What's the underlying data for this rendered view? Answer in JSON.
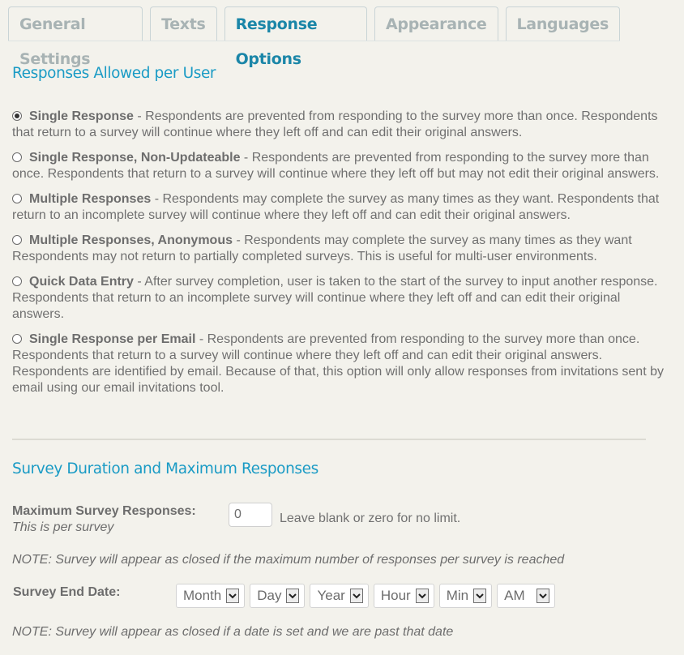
{
  "tabs": [
    {
      "label": "General Settings",
      "active": false
    },
    {
      "label": "Texts",
      "active": false
    },
    {
      "label": "Response Options",
      "active": true
    },
    {
      "label": "Appearance",
      "active": false
    },
    {
      "label": "Languages",
      "active": false
    }
  ],
  "responses_section": {
    "title": "Responses Allowed per User",
    "options": [
      {
        "title": "Single Response",
        "description": " - Respondents are prevented from responding to the survey more than once. Respondents that return to a survey will continue where they left off and can edit their original answers.",
        "checked": true
      },
      {
        "title": "Single Response, Non-Updateable",
        "description": " - Respondents are prevented from responding to the survey more than once. Respondents that return to a survey will continue where they left off but may not edit their original answers.",
        "checked": false
      },
      {
        "title": "Multiple Responses",
        "description": " - Respondents may complete the survey as many times as they want. Respondents that return to an incomplete survey will continue where they left off and can edit their original answers.",
        "checked": false
      },
      {
        "title": "Multiple Responses, Anonymous",
        "description": " - Respondents may complete the survey as many times as they want Respondents may not return to partially completed surveys. This is useful for multi-user environments.",
        "checked": false
      },
      {
        "title": "Quick Data Entry",
        "description": " - After survey completion, user is taken to the start of the survey to input another response. Respondents that return to an incomplete survey will continue where they left off and can edit their original answers.",
        "checked": false
      },
      {
        "title": "Single Response per Email",
        "description": " - Respondents are prevented from responding to the survey more than once. Respondents that return to a survey will continue where they left off and can edit their original answers. Respondents are identified by email. Because of that, this option will only allow responses from invitations sent by email using our email invitations tool.",
        "checked": false
      }
    ]
  },
  "duration_section": {
    "title": "Survey Duration and Maximum Responses",
    "max_responses_label": "Maximum Survey Responses:",
    "max_responses_sublabel": "This is per survey",
    "max_responses_value": "0",
    "max_responses_hint": "Leave blank or zero for no limit.",
    "max_note": "NOTE: Survey will appear as closed if the maximum number of responses per survey is reached",
    "end_date_label": "Survey End Date:",
    "end_date_selects": [
      "Month",
      "Day",
      "Year",
      "Hour",
      "Min",
      "AM"
    ],
    "end_date_note": "NOTE: Survey will appear as closed if a date is set and we are past that date"
  }
}
